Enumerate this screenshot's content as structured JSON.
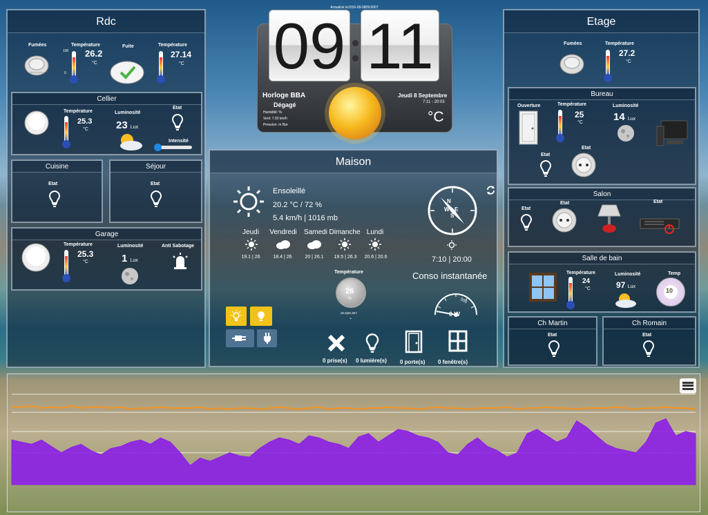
{
  "clock": {
    "hours": "09",
    "minutes": "11",
    "updated": "Actualisé le2016-09-0809:0007",
    "city": "Horloge BBA",
    "condition": "Dégagé",
    "humidity": "Humidité: %",
    "wind": "Vent: 7.93 km/h",
    "pressure": "Pression: m Bar",
    "date": "Jeudi 8 Septembre",
    "time_range": "7:11 - 20:03",
    "temp_unit": "°C"
  },
  "rdc": {
    "title": "Rdc",
    "fumees": "Fumées",
    "temp_label": "Température",
    "temp1": "26.2",
    "temp_unit": "°C",
    "fuite": "Fuite",
    "temp2": "27.14",
    "therm_max": "100",
    "therm_min": "0",
    "cellier": {
      "title": "Cellier",
      "temp_label": "Température",
      "temp": "25.3",
      "unit": "°C",
      "lum_label": "Luminosité",
      "lum": "23",
      "lum_unit": "Lux",
      "etat": "Etat",
      "intensite": "Intensité",
      "intensity_value": 0.0
    },
    "cuisine": {
      "title": "Cuisine",
      "etat": "Etat"
    },
    "sejour": {
      "title": "Séjour",
      "etat": "Etat"
    },
    "garage": {
      "title": "Garage",
      "temp_label": "Température",
      "temp": "25.3",
      "unit": "°C",
      "lum_label": "Luminosité",
      "lum": "1",
      "lum_unit": "Lux",
      "anti": "Anti Sabotage"
    }
  },
  "maison": {
    "title": "Maison",
    "condition": "Ensoleillé",
    "temp_hum": "20.2 °C / 72 %",
    "wind_pressure": "5.4 km/h | 1016 mb",
    "forecast": [
      {
        "day": "Jeudi",
        "temps": "19.1 | 26",
        "icon": "sun-icon"
      },
      {
        "day": "Vendredi",
        "temps": "18.4 | 26",
        "icon": "cloud-icon"
      },
      {
        "day": "Samedi",
        "temps": "20 | 26.1",
        "icon": "cloud-icon"
      },
      {
        "day": "Dimanche",
        "temps": "19.5 | 26.3",
        "icon": "sun-icon"
      },
      {
        "day": "Lundi",
        "temps": "20.6 | 20.6",
        "icon": "sun-icon"
      }
    ],
    "compass": {
      "n": "N",
      "e": "E",
      "s": "S",
      "w": "W"
    },
    "sun_times": "7:10 | 20:00",
    "conso_title": "Conso instantanée",
    "gauge_max": "500",
    "gauge_value": "0 W",
    "temp_label": "Température",
    "temp_value": "26",
    "temp_unit": "%",
    "temp_range": "25.6|26.357",
    "temp_dash": "-",
    "counters": [
      {
        "label": "0 prise(s)",
        "icon": "close-x-icon"
      },
      {
        "label": "0 lumière(s)",
        "icon": "bulb-icon"
      },
      {
        "label": "0 porte(s)",
        "icon": "door-icon"
      },
      {
        "label": "0 fenêtre(s)",
        "icon": "window-icon"
      }
    ]
  },
  "etage": {
    "title": "Etage",
    "fumees": "Fumées",
    "temp_label": "Température",
    "temp": "27.2",
    "unit": "°C",
    "bureau": {
      "title": "Bureau",
      "ouverture": "Ouverture",
      "temp_label": "Température",
      "temp": "25",
      "unit": "°C",
      "lum_label": "Luminosité",
      "lum": "14",
      "lum_unit": "Lux",
      "etat1": "Etat",
      "etat2": "Etat"
    },
    "salon": {
      "title": "Salon",
      "etat1": "Etat",
      "etat2": "Etat",
      "etat3": "Etat"
    },
    "sdb": {
      "title": "Salle de bain",
      "temp_label": "Température",
      "temp": "24",
      "unit": "°C",
      "lum_label": "Luminosité",
      "lum": "97",
      "lum_unit": "Lux",
      "temp2_label": "Temp",
      "thermostat": "10"
    },
    "chmartin": {
      "title": "Ch Martin",
      "etat": "Etat"
    },
    "chromain": {
      "title": "Ch Romain",
      "etat": "Etat"
    }
  },
  "chart_data": {
    "type": "area",
    "title": "",
    "series": [
      {
        "type": "line",
        "color": "#f59320",
        "values": [
          73,
          73,
          74,
          72,
          73,
          72,
          74,
          72,
          73,
          73,
          72,
          73,
          71,
          72,
          72,
          73,
          72,
          72,
          72,
          73,
          71,
          72,
          71,
          72,
          72,
          71,
          72,
          73,
          72,
          71,
          72,
          73,
          71,
          72,
          72,
          71,
          72,
          72,
          73,
          72,
          72,
          71,
          72,
          73,
          72,
          72,
          71,
          72,
          72,
          72,
          73,
          71,
          72,
          72,
          73,
          72,
          72,
          71,
          72,
          72,
          72,
          73,
          72,
          71,
          72,
          72,
          73,
          72,
          72,
          71
        ]
      },
      {
        "type": "area",
        "color": "#8b1fe6",
        "values": [
          42,
          40,
          38,
          42,
          36,
          30,
          35,
          38,
          32,
          28,
          34,
          36,
          40,
          42,
          38,
          44,
          40,
          30,
          18,
          25,
          22,
          26,
          30,
          27,
          26,
          34,
          40,
          44,
          42,
          38,
          46,
          44,
          40,
          38,
          34,
          45,
          48,
          40,
          46,
          52,
          50,
          46,
          44,
          40,
          30,
          28,
          38,
          44,
          36,
          32,
          26,
          30,
          48,
          52,
          46,
          40,
          44,
          60,
          54,
          46,
          38,
          34,
          32,
          30,
          40,
          58,
          62,
          46,
          50,
          48
        ]
      },
      {
        "type": "line",
        "color": "#ffffff",
        "values": []
      }
    ],
    "ylim": [
      0,
      100
    ],
    "grid": true
  },
  "chart_menu": "menu-icon"
}
